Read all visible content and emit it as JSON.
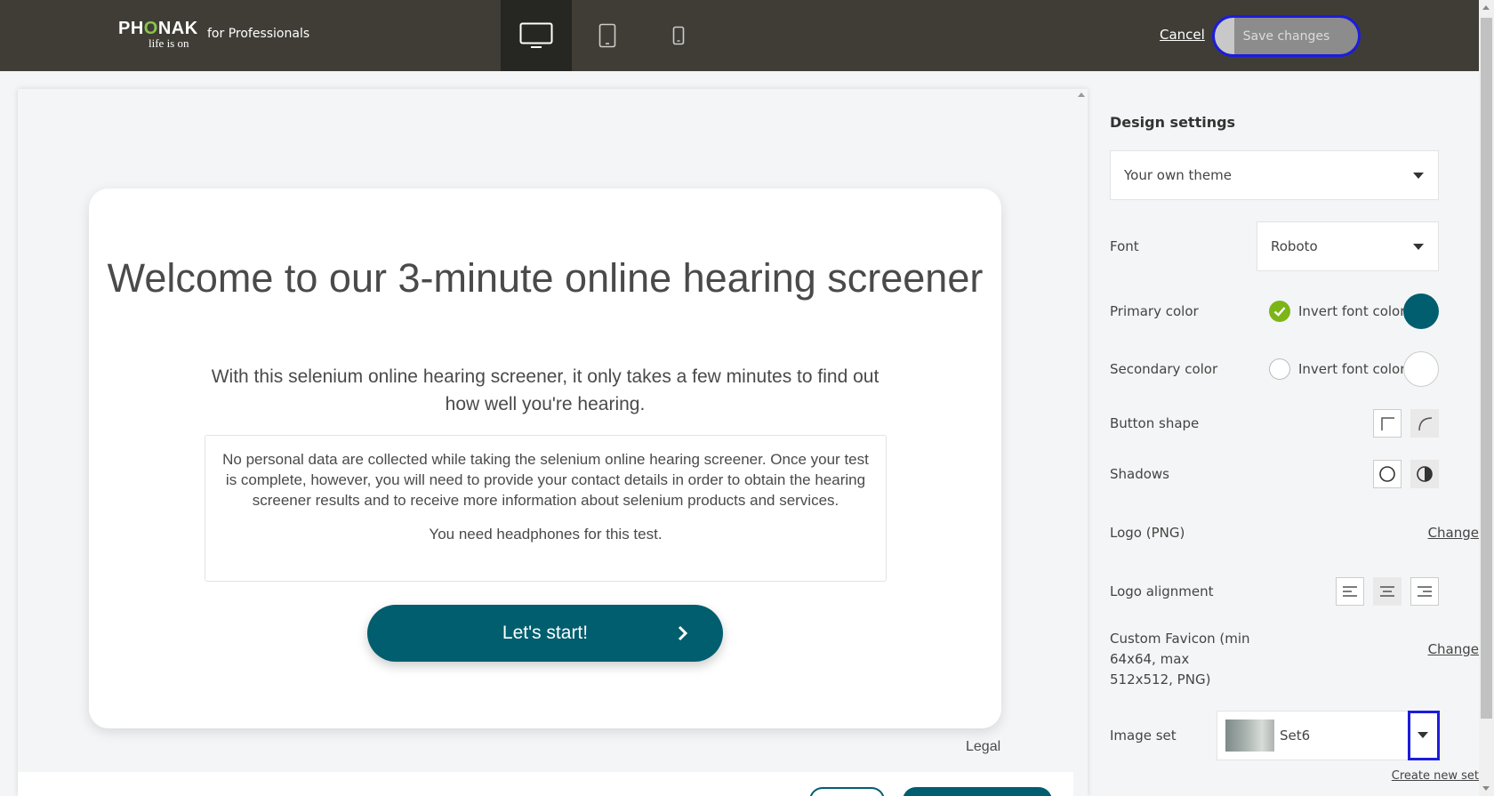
{
  "header": {
    "brand": "PHONAK",
    "brand_tagline": "life is on",
    "brand_suffix": "for Professionals",
    "devices": [
      {
        "name": "desktop-icon",
        "active": true
      },
      {
        "name": "tablet-icon",
        "active": false
      },
      {
        "name": "mobile-icon",
        "active": false
      }
    ],
    "cancel_label": "Cancel",
    "save_label": "Save changes"
  },
  "preview": {
    "title": "Welcome to our 3-minute online hearing screener",
    "subtitle": "With this selenium online hearing screener, it only takes a few minutes to find out how well you're hearing.",
    "info_text": "No personal data are collected while taking the selenium online hearing screener. Once your test is complete, however, you will need to provide your contact details in order to obtain the hearing screener results and to receive more information about selenium products and services.",
    "headphones_text": "You need headphones for this test.",
    "start_label": "Let's start!",
    "legal_label": "Legal",
    "primary_color": "#005e6e"
  },
  "settings": {
    "title": "Design settings",
    "theme_value": "Your own theme",
    "font_label": "Font",
    "font_value": "Roboto",
    "primary_color_label": "Primary color",
    "primary_invert_label": "Invert font color",
    "primary_invert_checked": true,
    "primary_color": "#005e6e",
    "secondary_color_label": "Secondary color",
    "secondary_invert_label": "Invert font color",
    "secondary_invert_checked": false,
    "secondary_color": "#ffffff",
    "button_shape_label": "Button shape",
    "shadows_label": "Shadows",
    "logo_label": "Logo (PNG)",
    "logo_change_label": "Change",
    "logo_alignment_label": "Logo alignment",
    "favicon_label": "Custom Favicon (min 64x64, max 512x512, PNG)",
    "favicon_change_label": "Change",
    "image_set_label": "Image set",
    "image_set_value": "Set6",
    "create_set_label": "Create new set"
  }
}
